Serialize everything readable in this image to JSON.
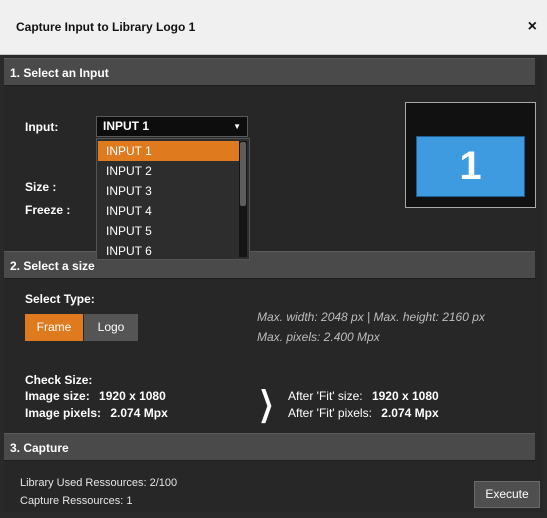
{
  "dialog": {
    "title": "Capture Input to Library Logo 1",
    "close_label": "×"
  },
  "section1": {
    "header": "1. Select an Input",
    "input_label": "Input:",
    "selected_input": "INPUT 1",
    "size_label": "Size :",
    "freeze_label": "Freeze :",
    "options": [
      "INPUT 1",
      "INPUT 2",
      "INPUT 3",
      "INPUT 4",
      "INPUT 5",
      "INPUT 6"
    ],
    "preview_number": "1"
  },
  "section2": {
    "header": "2. Select a size",
    "select_type_label": "Select Type:",
    "frame_label": "Frame",
    "logo_label": "Logo",
    "max_dims": "Max. width: 2048 px  |  Max. height: 2160 px",
    "max_pixels": "Max. pixels: 2.400 Mpx",
    "check_size_label": "Check Size:",
    "image_size_label": "Image size:",
    "image_size_value": "1920 x 1080",
    "image_pixels_label": "Image pixels:",
    "image_pixels_value": "2.074 Mpx",
    "after_fit_size_label": "After 'Fit' size:",
    "after_fit_size_value": "1920 x 1080",
    "after_fit_pixels_label": "After 'Fit' pixels:",
    "after_fit_pixels_value": "2.074 Mpx",
    "chevron": "❯"
  },
  "section3": {
    "header": "3. Capture",
    "library_used": "Library Used Ressources: 2/100",
    "capture_resources": "Capture Ressources: 1",
    "execute_label": "Execute"
  },
  "colors": {
    "accent": "#e07a1f",
    "preview_blue": "#3f9be0"
  }
}
